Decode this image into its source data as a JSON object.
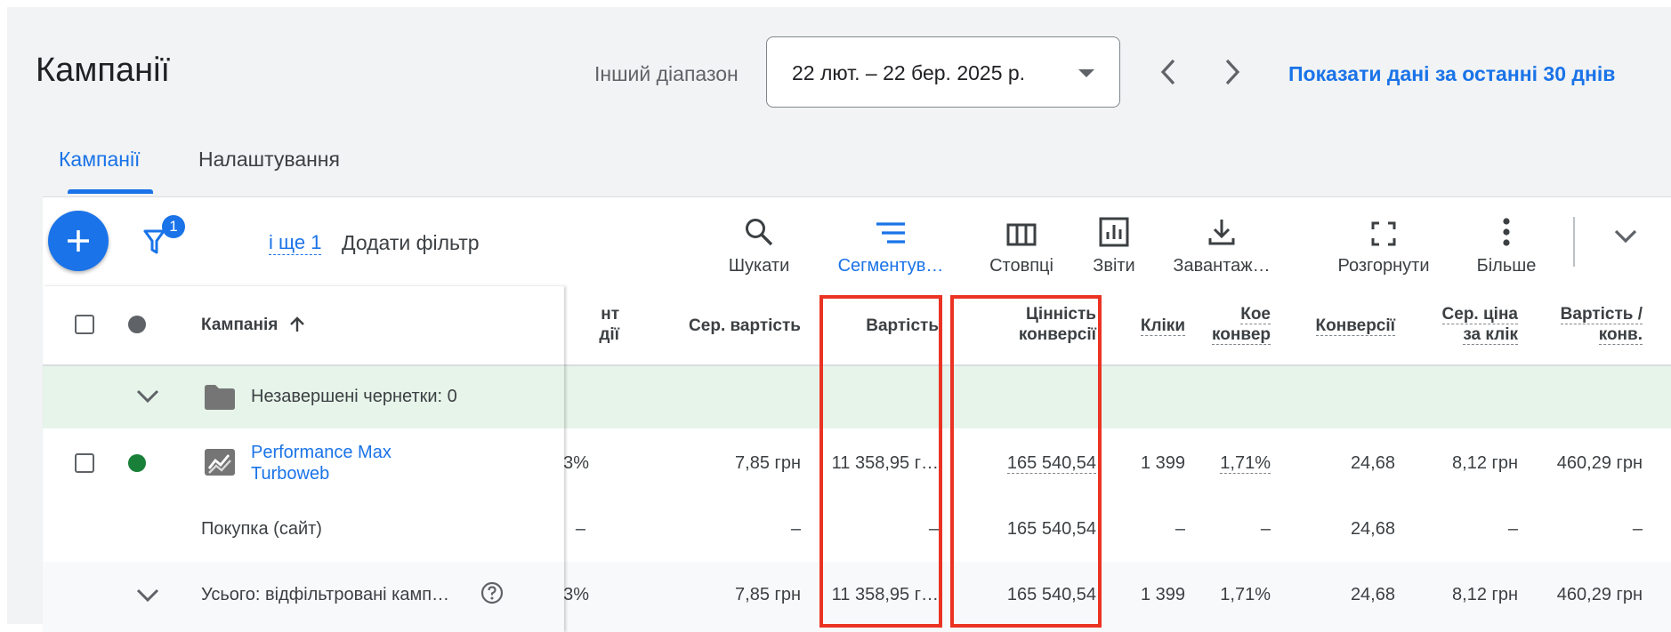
{
  "header": {
    "title": "Кампанії",
    "range_label": "Інший діапазон",
    "date_range": "22 лют. – 22 бер. 2025 р.",
    "show_30_days": "Показати дані за останні 30 днів"
  },
  "tabs": [
    {
      "label": "Кампанії",
      "active": true
    },
    {
      "label": "Налаштування",
      "active": false
    }
  ],
  "toolbar": {
    "filter_count": "1",
    "and_more": "і ще 1",
    "add_filter": "Додати фільтр",
    "tools": {
      "search": "Шукати",
      "segment": "Сегментув…",
      "columns": "Стовпці",
      "reports": "Звіти",
      "download": "Завантаж…",
      "expand": "Розгорнути",
      "more": "Більше"
    }
  },
  "table": {
    "headers": {
      "campaign": "Кампанія",
      "conv_rate_line1": "нт",
      "conv_rate_line2": "дії",
      "avg_cost": "Сер. вартість",
      "cost": "Вартість",
      "conv_value_line1": "Цінність",
      "conv_value_line2": "конверсії",
      "clicks": "Кліки",
      "coef_line1": "Кое",
      "coef_line2": "конвер",
      "conversions": "Конверсії",
      "avg_cpc_line1": "Сер. ціна",
      "avg_cpc_line2": "за клік",
      "cost_per_conv_line1": "Вартість /",
      "cost_per_conv_line2": "конв."
    },
    "drafts_row": {
      "label": "Незавершені чернетки: 0"
    },
    "campaign_row": {
      "name_line1": "Performance Max",
      "name_line2": "Turboweb",
      "conv_rate": "3%",
      "avg_cost": "7,85 грн",
      "cost": "11 358,95 г…",
      "conv_value": "165 540,54",
      "clicks": "1 399",
      "coef": "1,71%",
      "conversions": "24,68",
      "avg_cpc": "8,12 грн",
      "cost_per_conv": "460,29 грн"
    },
    "purchase_row": {
      "label": "Покупка (сайт)",
      "conv_rate": "–",
      "avg_cost": "–",
      "cost": "–",
      "conv_value": "165 540,54",
      "clicks": "–",
      "coef": "–",
      "conversions": "24,68",
      "avg_cpc": "–",
      "cost_per_conv": "–"
    },
    "total_row": {
      "label": "Усього: відфільтровані камп…",
      "conv_rate": "3%",
      "avg_cost": "7,85 грн",
      "cost": "11 358,95 г…",
      "conv_value": "165 540,54",
      "clicks": "1 399",
      "coef": "1,71%",
      "conversions": "24,68",
      "avg_cpc": "8,12 грн",
      "cost_per_conv": "460,29 грн"
    }
  },
  "colors": {
    "accent": "#1a73e8",
    "highlight": "#ea3323",
    "active_status": "#188038",
    "drafts_row_bg": "#e6f4ea"
  }
}
